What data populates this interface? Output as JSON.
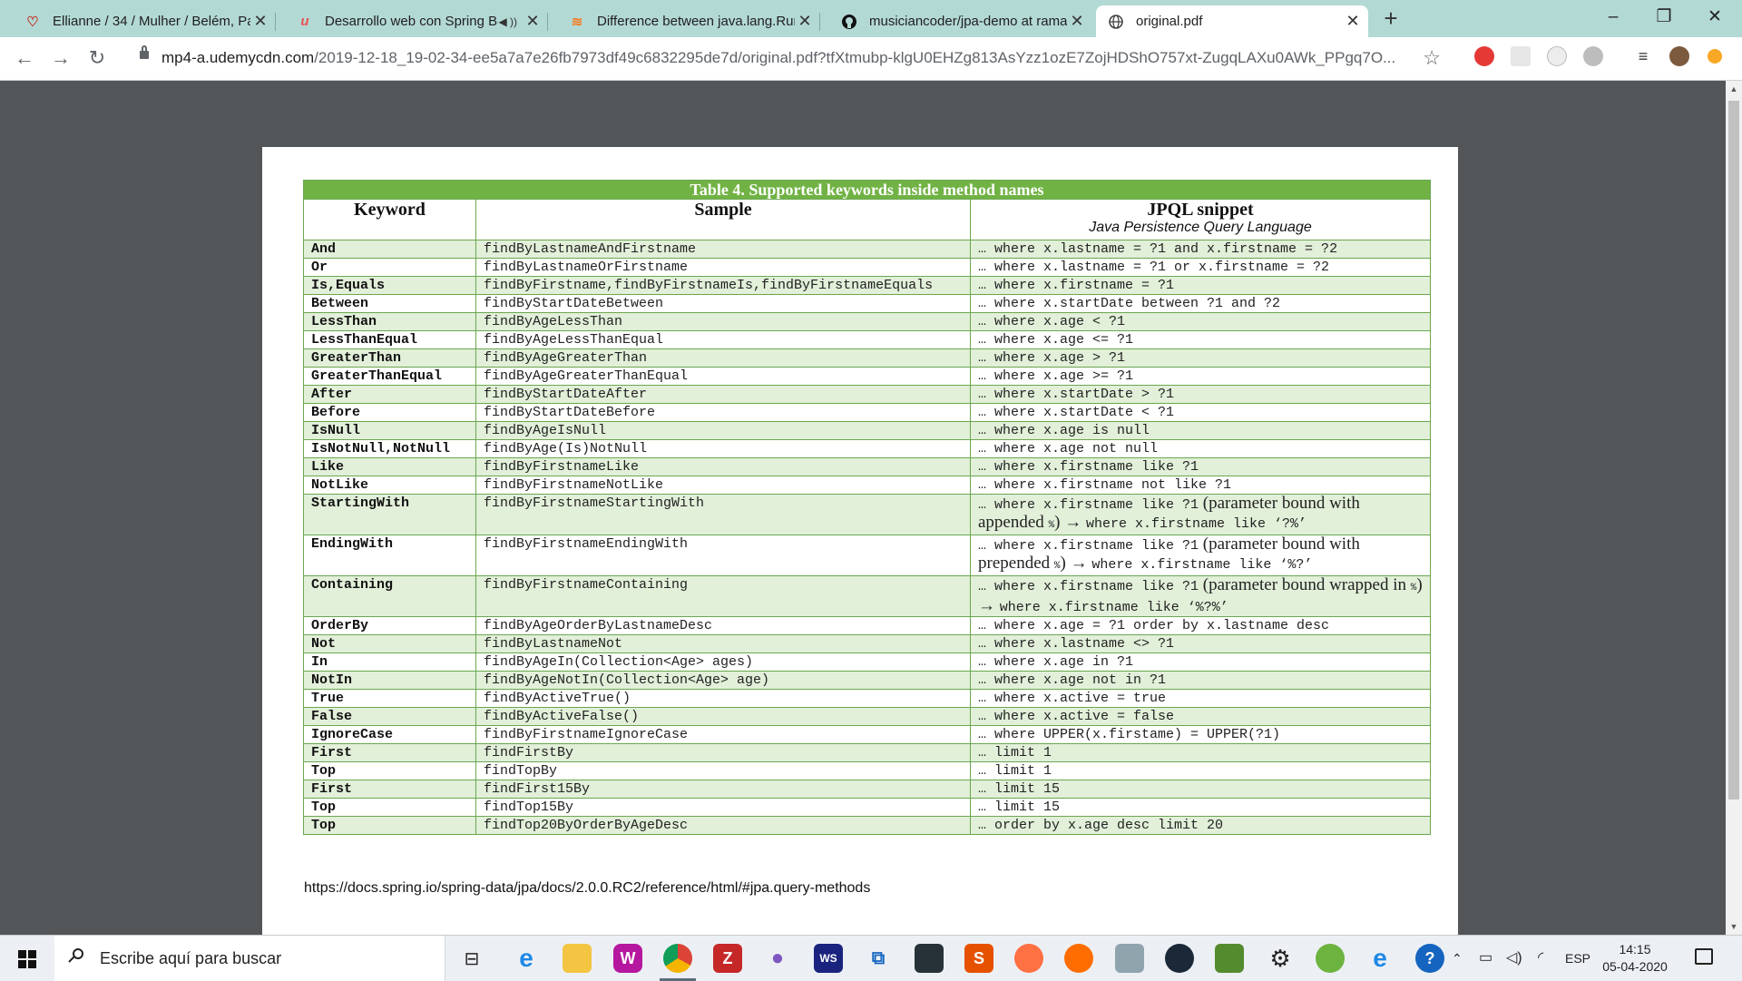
{
  "tabs": [
    {
      "title": "Ellianne / 34 / Mulher / Belém, Pa",
      "icon": "heart-icon",
      "close": "✕"
    },
    {
      "title": "Desarrollo web con Spring Bo",
      "icon": "udemy-icon",
      "close": "✕"
    },
    {
      "title": "Difference between java.lang.Run",
      "icon": "stackoverflow-icon",
      "close": "✕"
    },
    {
      "title": "musiciancoder/jpa-demo at rama",
      "icon": "github-icon",
      "close": "✕"
    },
    {
      "title": "original.pdf",
      "icon": "globe-icon",
      "close": "✕",
      "active": true
    }
  ],
  "address": {
    "host": "mp4-a.udemycdn.com",
    "path": "/2019-12-18_19-02-34-ee5a7a7e26fb7973df49c6832295de7d/original.pdf?tfXtmubp-klgU0EHZg813AsYzz1ozE7ZojHDShO757xt-ZugqLAXu0AWk_PPgq7O..."
  },
  "pdf": {
    "caption": "Table 4. Supported keywords inside method names",
    "headers": {
      "keyword": "Keyword",
      "sample": "Sample",
      "jpql": "JPQL snippet",
      "jpql_sub": "Java Persistence Query Language"
    },
    "rows": [
      {
        "kw": "And",
        "sample": "findByLastnameAndFirstname",
        "jpql": "… where x.lastname = ?1 and x.firstname = ?2"
      },
      {
        "kw": "Or",
        "sample": "findByLastnameOrFirstname",
        "jpql": "… where x.lastname = ?1 or x.firstname = ?2"
      },
      {
        "kw": "Is,Equals",
        "sample": "findByFirstname,findByFirstnameIs,findByFirstnameEquals",
        "jpql": "… where x.firstname = ?1"
      },
      {
        "kw": "Between",
        "sample": "findByStartDateBetween",
        "jpql": "… where x.startDate between ?1 and ?2"
      },
      {
        "kw": "LessThan",
        "sample": "findByAgeLessThan",
        "jpql": "… where x.age < ?1"
      },
      {
        "kw": "LessThanEqual",
        "sample": "findByAgeLessThanEqual",
        "jpql": "… where x.age <= ?1"
      },
      {
        "kw": "GreaterThan",
        "sample": "findByAgeGreaterThan",
        "jpql": "… where x.age > ?1"
      },
      {
        "kw": "GreaterThanEqual",
        "sample": "findByAgeGreaterThanEqual",
        "jpql": "… where x.age >= ?1"
      },
      {
        "kw": "After",
        "sample": "findByStartDateAfter",
        "jpql": "… where x.startDate > ?1"
      },
      {
        "kw": "Before",
        "sample": "findByStartDateBefore",
        "jpql": "… where x.startDate < ?1"
      },
      {
        "kw": "IsNull",
        "sample": "findByAgeIsNull",
        "jpql": "… where x.age is null"
      },
      {
        "kw": "IsNotNull,NotNull",
        "sample": "findByAge(Is)NotNull",
        "jpql": "… where x.age not null"
      },
      {
        "kw": "Like",
        "sample": "findByFirstnameLike",
        "jpql": "… where x.firstname like ?1"
      },
      {
        "kw": "NotLike",
        "sample": "findByFirstnameNotLike",
        "jpql": "… where x.firstname not like ?1"
      },
      {
        "kw": "StartingWith",
        "sample": "findByFirstnameStartingWith",
        "tall": true,
        "jpql_a": "… where x.firstname like ?1",
        "jpql_b": " (parameter bound with appended ",
        "jpql_c": "%",
        "jpql_d": ") → ",
        "jpql_e": "where x.firstname like ‘?%’"
      },
      {
        "kw": "EndingWith",
        "sample": "findByFirstnameEndingWith",
        "tall": true,
        "jpql_a": "… where x.firstname like ?1",
        "jpql_b": " (parameter bound with prepended ",
        "jpql_c": "%",
        "jpql_d": ") → ",
        "jpql_e": "where x.firstname like ‘%?’"
      },
      {
        "kw": "Containing",
        "sample": "findByFirstnameContaining",
        "tall": true,
        "jpql_a": "… where x.firstname like ?1",
        "jpql_b": " (parameter bound wrapped in ",
        "jpql_c": "%",
        "jpql_d": ") → ",
        "jpql_e": "where x.firstname like ‘%?%’"
      },
      {
        "kw": "OrderBy",
        "sample": "findByAgeOrderByLastnameDesc",
        "jpql": "… where x.age = ?1 order by x.lastname desc"
      },
      {
        "kw": "Not",
        "sample": "findByLastnameNot",
        "jpql": "… where x.lastname <> ?1"
      },
      {
        "kw": "In",
        "sample": "findByAgeIn(Collection<Age> ages)",
        "jpql": "… where x.age in ?1"
      },
      {
        "kw": "NotIn",
        "sample": "findByAgeNotIn(Collection<Age> age)",
        "jpql": "… where x.age not in ?1"
      },
      {
        "kw": "True",
        "sample": "findByActiveTrue()",
        "jpql": "… where x.active = true"
      },
      {
        "kw": "False",
        "sample": "findByActiveFalse()",
        "jpql": "… where x.active = false"
      },
      {
        "kw": "IgnoreCase",
        "sample": "findByFirstnameIgnoreCase",
        "jpql": "… where UPPER(x.firstame) = UPPER(?1)"
      },
      {
        "kw": "First",
        "sample": "findFirstBy",
        "jpql": "… limit 1"
      },
      {
        "kw": "Top",
        "sample": "findTopBy",
        "jpql": "… limit 1"
      },
      {
        "kw": "First",
        "sample": "findFirst15By",
        "jpql": "… limit 15"
      },
      {
        "kw": "Top",
        "sample": "findTop15By",
        "jpql": "… limit 15"
      },
      {
        "kw": "Top",
        "sample": "findTop20ByOrderByAgeDesc",
        "jpql": "… order by x.age desc limit 20"
      }
    ],
    "footer_url": "https://docs.spring.io/spring-data/jpa/docs/2.0.0.RC2/reference/html/#jpa.query-methods"
  },
  "taskbar": {
    "search_placeholder": "Escribe aquí para buscar",
    "language": "ESP",
    "time": "14:15",
    "date": "05-04-2020"
  },
  "colors": {
    "table_header_green": "#71b245",
    "row_band_green": "#e2efd9",
    "tab_strip": "#b3d9d5"
  }
}
